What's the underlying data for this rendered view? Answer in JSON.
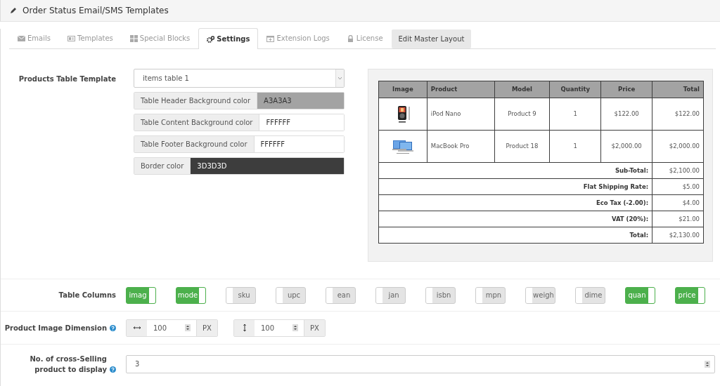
{
  "header": {
    "title": "Order Status Email/SMS Templates"
  },
  "tabs": [
    {
      "label": "Emails",
      "selected": false
    },
    {
      "label": "Templates",
      "selected": false
    },
    {
      "label": "Special Blocks",
      "selected": false
    },
    {
      "label": "Settings",
      "selected": true
    },
    {
      "label": "Extension Logs",
      "selected": false
    },
    {
      "label": "License",
      "selected": false
    }
  ],
  "edit_button": "Edit Master Layout",
  "products_table_template": {
    "label": "Products Table Template",
    "value": "items table 1",
    "colors": [
      {
        "label": "Table Header Background color",
        "value": "A3A3A3",
        "color": "#a3a3a3"
      },
      {
        "label": "Table Content Background color",
        "value": "FFFFFF",
        "color": "#ffffff"
      },
      {
        "label": "Table Footer Background color",
        "value": "FFFFFF",
        "color": "#ffffff"
      },
      {
        "label": "Border color",
        "value": "3D3D3D",
        "color": "#3d3d3d"
      }
    ]
  },
  "preview": {
    "columns": [
      "Image",
      "Product",
      "Model",
      "Quantity",
      "Price",
      "Total"
    ],
    "rows": [
      {
        "product": "iPod Nano",
        "model": "Product 9",
        "quantity": "1",
        "price": "$122.00",
        "total": "$122.00"
      },
      {
        "product": "MacBook Pro",
        "model": "Product 18",
        "quantity": "1",
        "price": "$2,000.00",
        "total": "$2,000.00"
      }
    ],
    "totals": [
      {
        "label": "Sub-Total:",
        "value": "$2,100.00"
      },
      {
        "label": "Flat Shipping Rate:",
        "value": "$5.00"
      },
      {
        "label": "Eco Tax (-2.00):",
        "value": "$4.00"
      },
      {
        "label": "VAT (20%):",
        "value": "$21.00"
      },
      {
        "label": "Total:",
        "value": "$2,130.00"
      }
    ]
  },
  "table_columns": {
    "label": "Table Columns",
    "toggles": [
      {
        "label": "imag",
        "on": true
      },
      {
        "label": "mode",
        "on": true
      },
      {
        "label": "sku",
        "on": false
      },
      {
        "label": "upc",
        "on": false
      },
      {
        "label": "ean",
        "on": false
      },
      {
        "label": "jan",
        "on": false
      },
      {
        "label": "isbn",
        "on": false
      },
      {
        "label": "mpn",
        "on": false
      },
      {
        "label": "weigh",
        "on": false
      },
      {
        "label": "dime",
        "on": false
      },
      {
        "label": "quan",
        "on": true
      },
      {
        "label": "price",
        "on": true
      }
    ]
  },
  "image_dimension": {
    "label": "Product Image Dimension",
    "width": {
      "value": "100",
      "unit": "PX"
    },
    "height": {
      "value": "100",
      "unit": "PX"
    }
  },
  "cross_selling": {
    "label": "No. of cross-Selling product to display",
    "value": "3"
  }
}
